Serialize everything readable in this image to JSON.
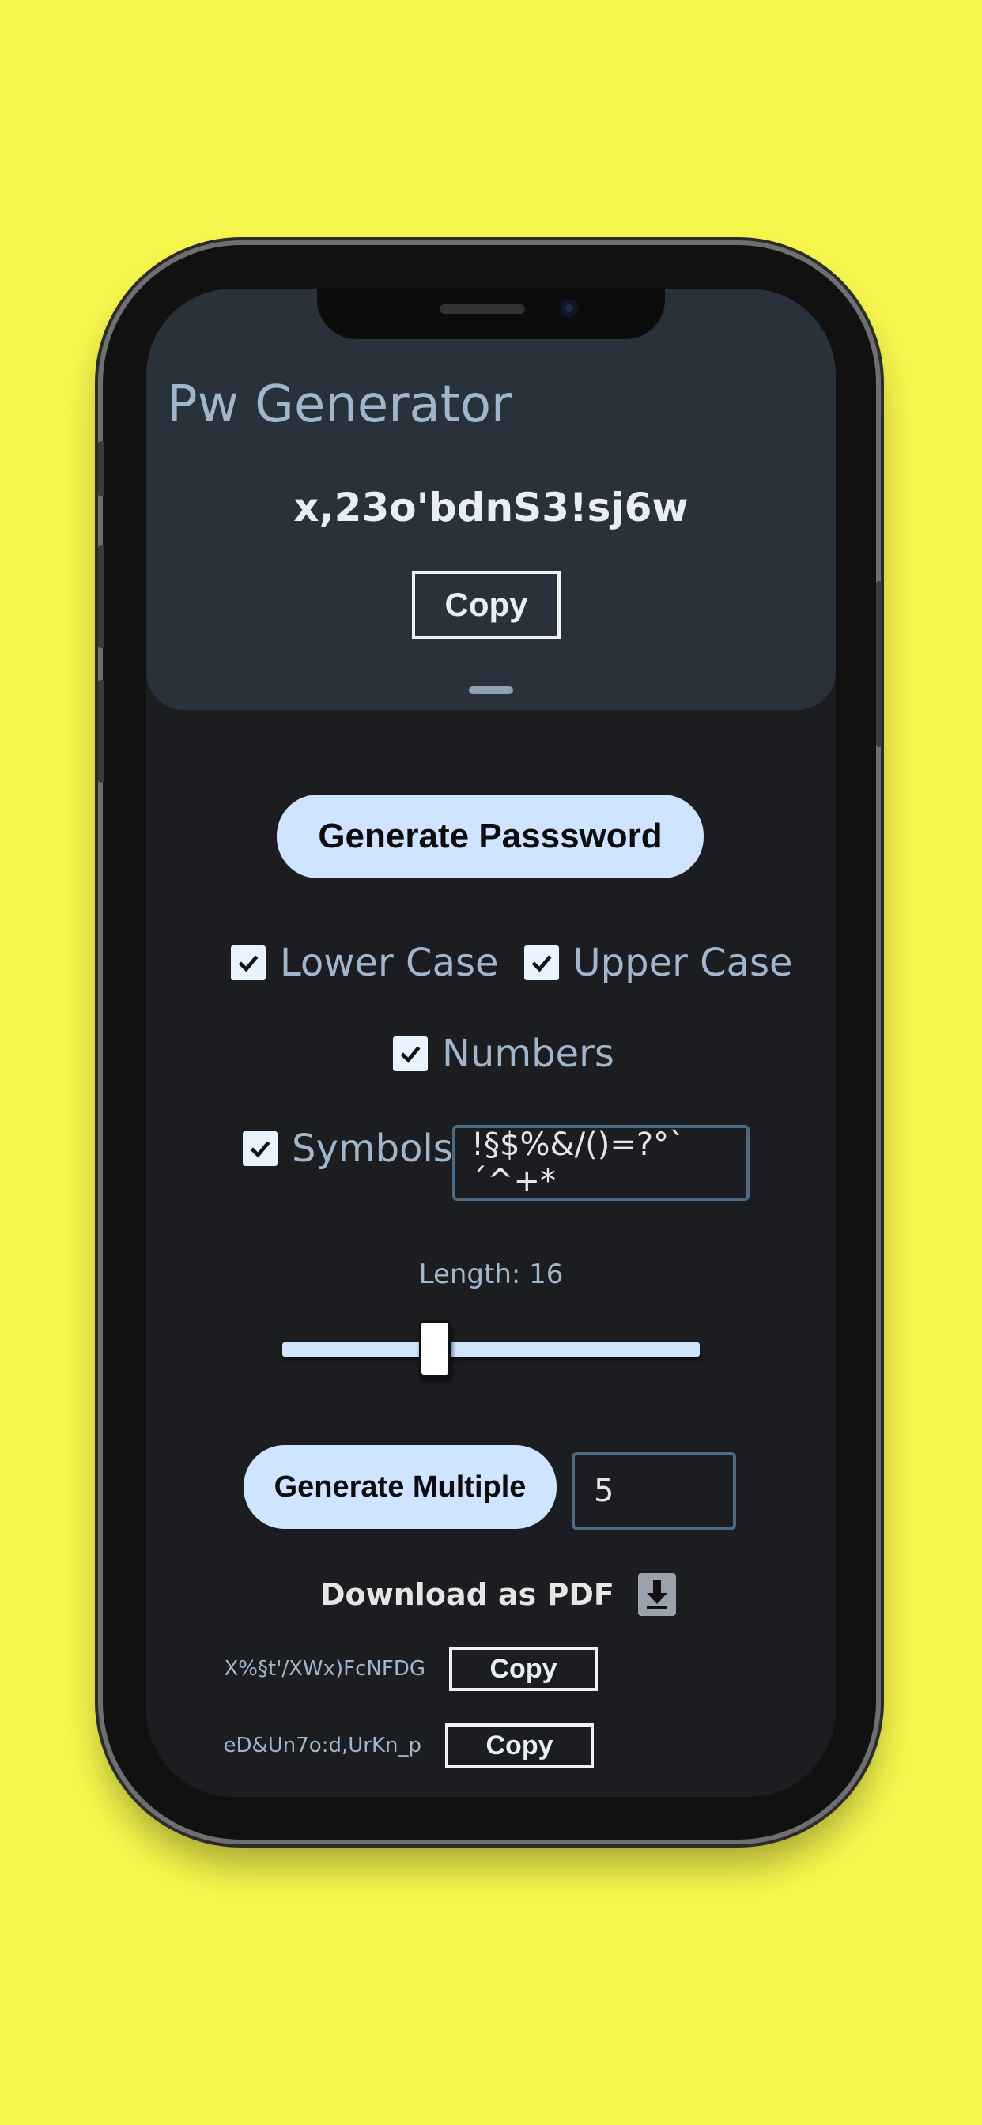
{
  "app": {
    "title": "Pw Generator",
    "generated_password": "x,23o'bdnS3!sj6w",
    "copy_label": "Copy"
  },
  "actions": {
    "generate_password_label": "Generate Passsword",
    "generate_multiple_label": "Generate Multiple"
  },
  "options": {
    "lower_case": {
      "label": "Lower Case",
      "checked": true
    },
    "upper_case": {
      "label": "Upper Case",
      "checked": true
    },
    "numbers": {
      "label": "Numbers",
      "checked": true
    },
    "symbols": {
      "label": "Symbols",
      "checked": true,
      "value": "!§$%&/()=?°`´^+*"
    }
  },
  "length": {
    "label": "Length: 16",
    "value": 16
  },
  "multiple": {
    "count": "5"
  },
  "download": {
    "label": "Download as PDF",
    "icon": "download-icon"
  },
  "results": [
    {
      "password": "X%§t'/XWx)FcNFDG",
      "copy_label": "Copy"
    },
    {
      "password": "eD&Un7o:d,UrKn_p",
      "copy_label": "Copy"
    }
  ],
  "colors": {
    "background": "#f7f74d",
    "accent": "#cfe4ff",
    "header": "#29323a",
    "screen": "#1b1d20",
    "label": "#9fb6cc"
  }
}
